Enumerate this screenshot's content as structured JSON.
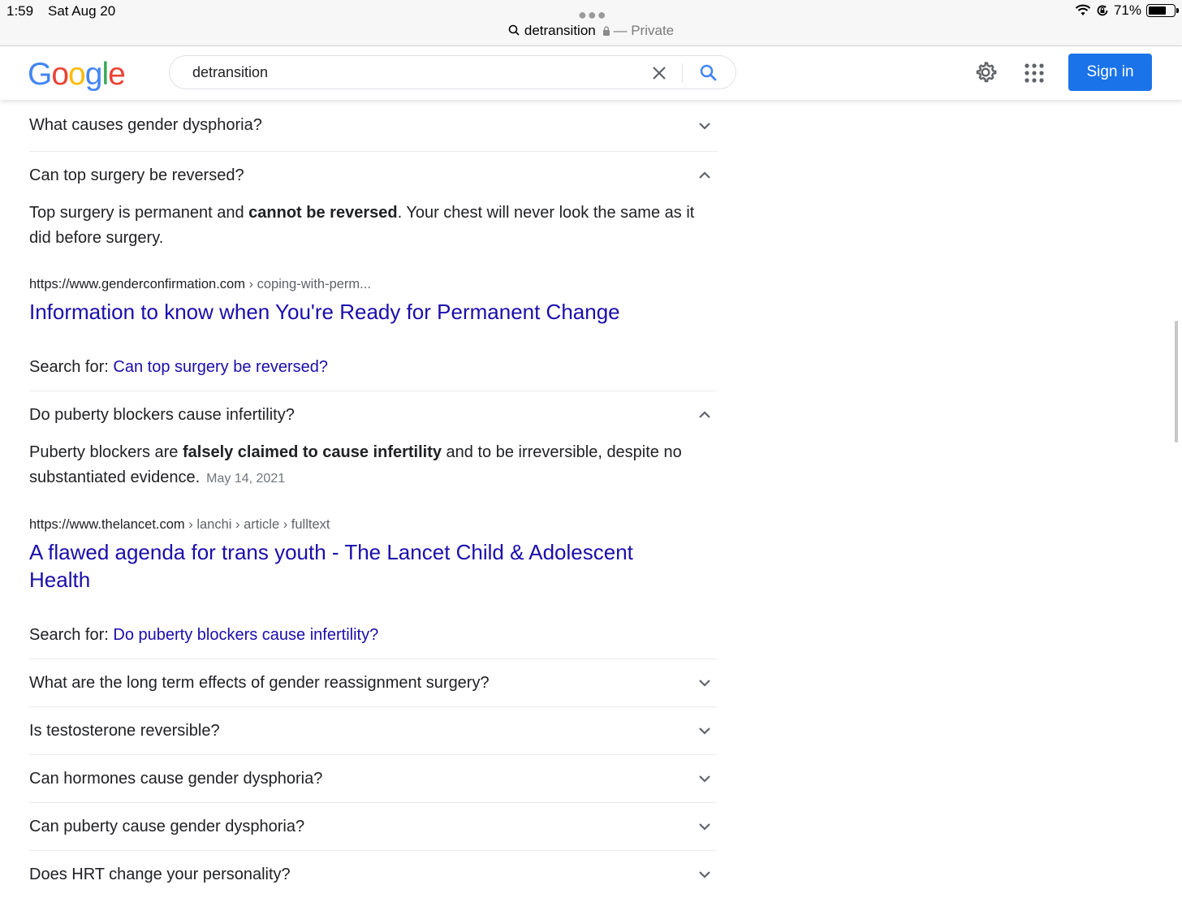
{
  "status": {
    "time": "1:59",
    "date": "Sat Aug 20",
    "battery": "71%",
    "battery_level": 0.71,
    "url_query": "detransition",
    "private_label": "— Private"
  },
  "header": {
    "logo_letters": [
      {
        "ch": "G",
        "color": "#4285F4"
      },
      {
        "ch": "o",
        "color": "#EA4335"
      },
      {
        "ch": "o",
        "color": "#FBBC05"
      },
      {
        "ch": "g",
        "color": "#4285F4"
      },
      {
        "ch": "l",
        "color": "#34A853"
      },
      {
        "ch": "e",
        "color": "#EA4335"
      }
    ],
    "search_value": "detransition",
    "sign_in": "Sign in"
  },
  "questions": {
    "q1": "What causes gender dysphoria?",
    "q2": {
      "question": "Can top surgery be reversed?",
      "answer_pre": "Top surgery is permanent and ",
      "answer_bold": "cannot be reversed",
      "answer_post": ". Your chest will never look the same as it did before surgery.",
      "cite_domain": "https://www.genderconfirmation.com",
      "cite_path": " › coping-with-perm...",
      "title": "Information to know when You're Ready for Permanent Change",
      "search_for_label": "Search for: ",
      "search_for_link": "Can top surgery be reversed?"
    },
    "q3": {
      "question": "Do puberty blockers cause infertility?",
      "answer_pre": "Puberty blockers are ",
      "answer_bold": "falsely claimed to cause infertility",
      "answer_post": " and to be irreversible, despite no substantiated evidence.",
      "date": "May 14, 2021",
      "cite_domain": "https://www.thelancet.com",
      "cite_path": " › lanchi › article › fulltext",
      "title": "A flawed agenda for trans youth - The Lancet Child & Adolescent Health",
      "search_for_label": "Search for: ",
      "search_for_link": "Do puberty blockers cause infertility?"
    },
    "q4": "What are the long term effects of gender reassignment surgery?",
    "q5": "Is testosterone reversible?",
    "q6": "Can hormones cause gender dysphoria?",
    "q7": "Can puberty cause gender dysphoria?",
    "q8": "Does HRT change your personality?"
  },
  "colors": {
    "link": "#1a0dab",
    "signin_bg": "#1a73e8"
  }
}
